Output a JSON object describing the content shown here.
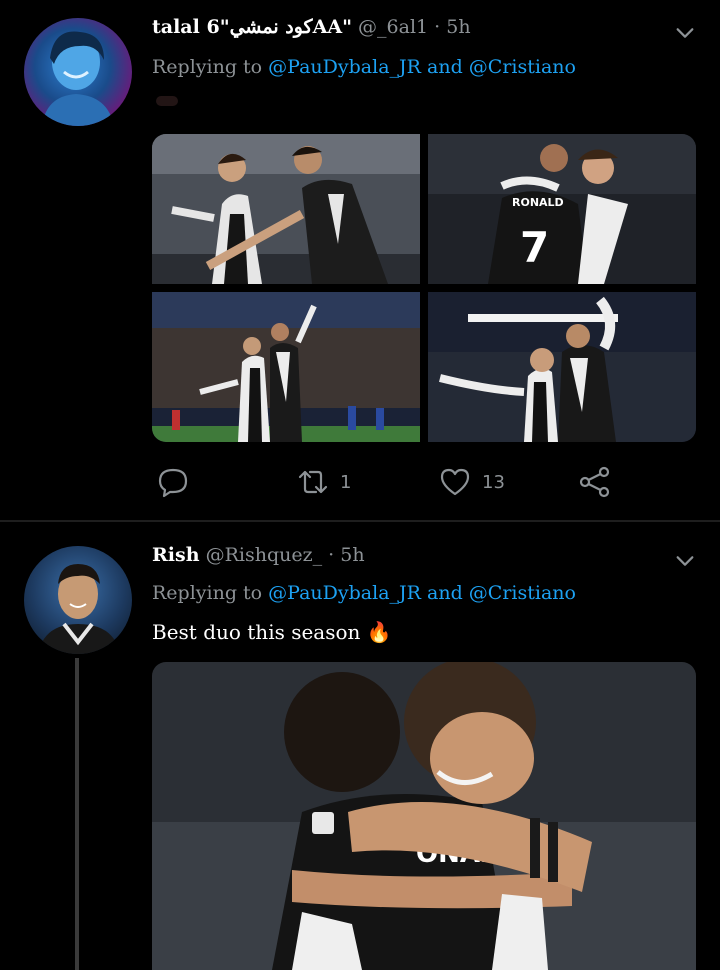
{
  "tweets": [
    {
      "name": "talal كود نمشي\"6AA\"",
      "handle": "@_6al1",
      "separator": "·",
      "time": "5h",
      "replying_prefix": "Replying to",
      "mention_1": "@PauDybala_JR",
      "mention_joiner": "and",
      "mention_2": "@Cristiano",
      "text": "",
      "actions": {
        "reply_count": "",
        "retweet_count": "1",
        "like_count": "13"
      }
    },
    {
      "name": "Rish",
      "handle": "@Rishquez_",
      "separator": "·",
      "time": "5h",
      "replying_prefix": "Replying to",
      "mention_1": "@PauDybala_JR",
      "mention_joiner": "and",
      "mention_2": "@Cristiano",
      "text": "Best duo this season 🔥"
    }
  ],
  "icons": {
    "caret": "chevron-down-icon",
    "reply": "reply-icon",
    "retweet": "retweet-icon",
    "like": "heart-icon",
    "share": "share-icon"
  },
  "colors": {
    "background": "#000000",
    "secondary_text": "#8d9296",
    "mention": "#1da1f2",
    "divider": "#1e1e1e"
  }
}
